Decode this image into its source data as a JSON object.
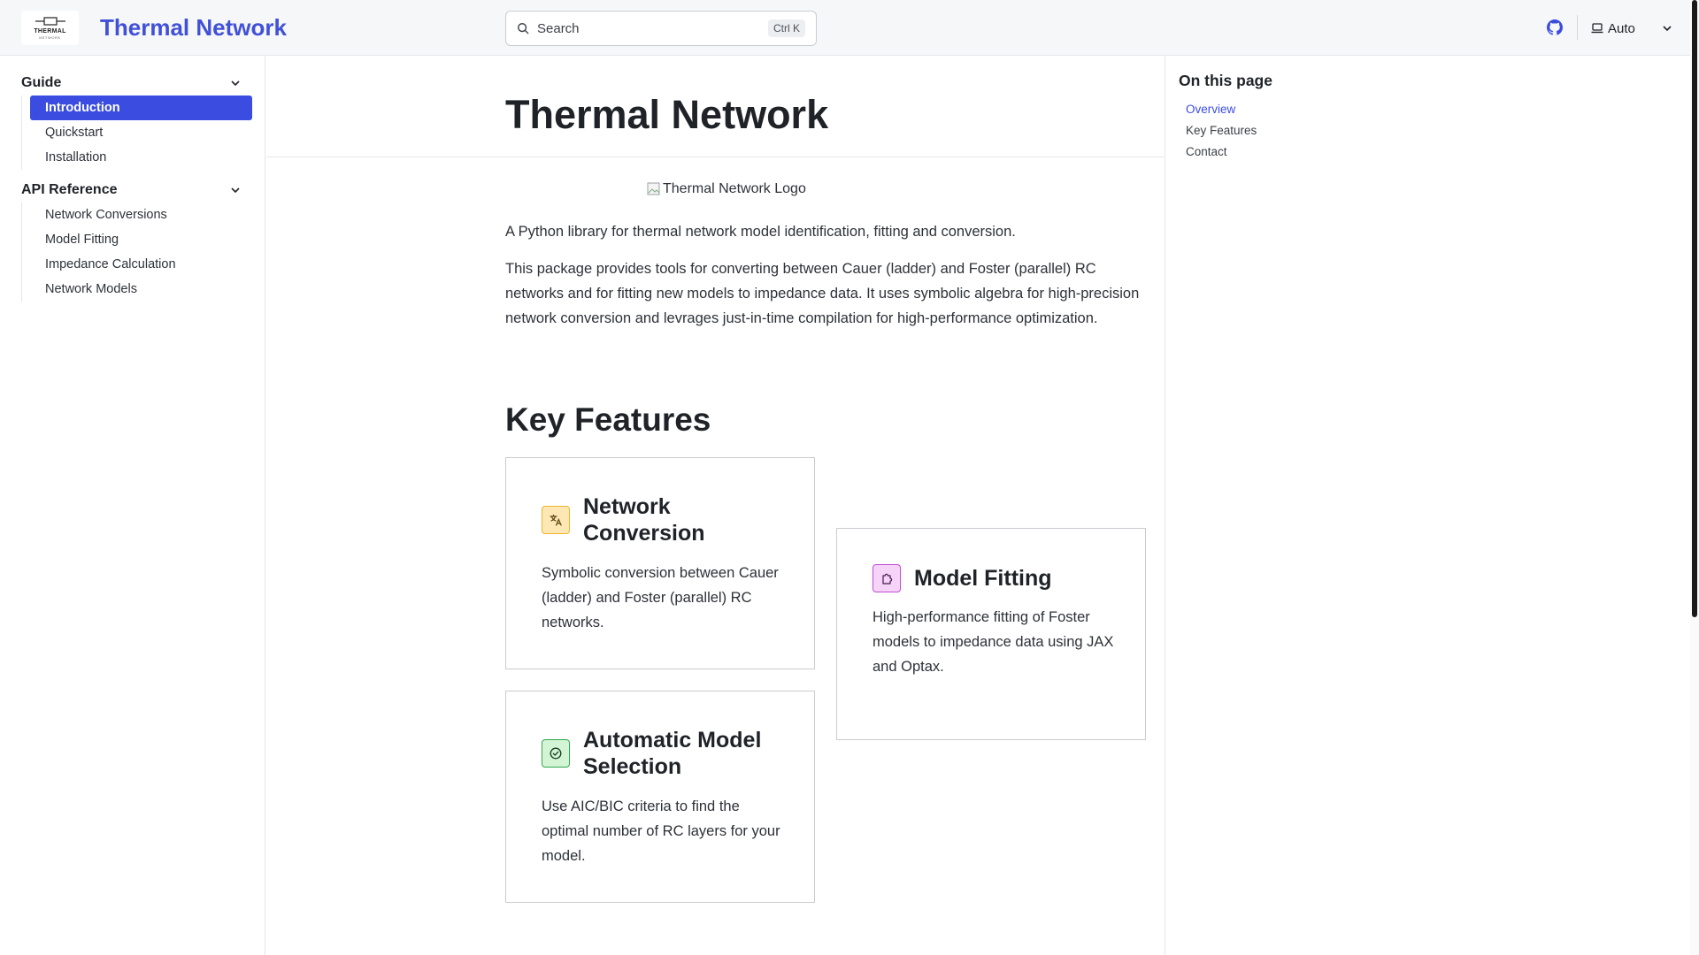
{
  "header": {
    "logo": {
      "text": "THERMAL",
      "sub": "NETWORK"
    },
    "site_title": "Thermal Network",
    "search": {
      "placeholder": "Search",
      "shortcut": "Ctrl K"
    },
    "theme_label": "Auto",
    "icons": {
      "search": "search-icon",
      "github": "github-icon",
      "theme": "laptop-icon",
      "dropdown": "chevron-down-icon"
    }
  },
  "sidebar": {
    "groups": [
      {
        "title": "Guide",
        "items": [
          "Introduction",
          "Quickstart",
          "Installation"
        ]
      },
      {
        "title": "API Reference",
        "items": [
          "Network Conversions",
          "Model Fitting",
          "Impedance Calculation",
          "Network Models"
        ]
      }
    ],
    "active_item": "Introduction"
  },
  "main": {
    "title": "Thermal Network",
    "logo_alt": "Thermal Network Logo",
    "intro": "A Python library for thermal network model identification, fitting and conversion.",
    "description": "This package provides tools for converting between Cauer (ladder) and Foster (parallel) RC networks and for fitting new models to impedance data. It uses symbolic algebra for high-precision network conversion and levrages just-in-time compilation for high-performance optimization.",
    "features_heading": "Key Features",
    "cards": [
      {
        "title": "Network Conversion",
        "desc": "Symbolic conversion between Cauer (ladder) and Foster (parallel) RC networks.",
        "icon": "translate-icon",
        "color": "#f0b429"
      },
      {
        "title": "Model Fitting",
        "desc": "High-performance fitting of Foster models to impedance data using JAX and Optax.",
        "icon": "puzzle-icon",
        "color": "#c54bd6"
      },
      {
        "title": "Automatic Model Selection",
        "desc": "Use AIC/BIC criteria to find the optimal number of RC layers for your model.",
        "icon": "check-circle-icon",
        "color": "#2fa84f"
      }
    ]
  },
  "toc": {
    "title": "On this page",
    "items": [
      "Overview",
      "Key Features",
      "Contact"
    ],
    "active": "Overview"
  },
  "colors": {
    "accent": "#3b4de0",
    "title_blue": "#4051d8"
  }
}
